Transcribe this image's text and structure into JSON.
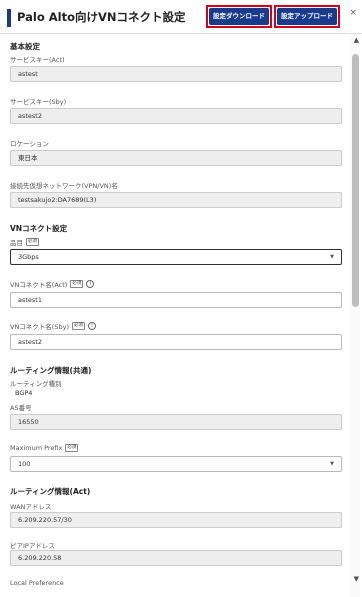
{
  "header": {
    "title": "Palo Alto向けVNコネクト設定",
    "download_label": "設定ダウンロード",
    "upload_label": "設定アップロード",
    "close_glyph": "×"
  },
  "basic": {
    "heading": "基本設定",
    "service_key_act_label": "サービスキー(Act)",
    "service_key_act_value": "astest",
    "service_key_sby_label": "サービスキー(Sby)",
    "service_key_sby_value": "astest2",
    "location_label": "ロケーション",
    "location_value": "東日本",
    "dest_network_label": "接続先仮想ネットワーク(VPN/VN)名",
    "dest_network_value": "testsakujo2:DA7689(L3)"
  },
  "vn": {
    "heading": "VNコネクト設定",
    "item_label": "品目",
    "item_value": "3Gbps",
    "name_act_label": "VNコネクト名(Act)",
    "name_act_value": "astest1",
    "name_sby_label": "VNコネクト名(Sby)",
    "name_sby_value": "astest2"
  },
  "routing_common": {
    "heading": "ルーティング情報(共通)",
    "type_label": "ルーティング種別",
    "type_value": "BGP4",
    "as_label": "AS番号",
    "as_value": "16550",
    "max_prefix_label": "Maximum Prefix",
    "max_prefix_value": "100"
  },
  "routing_act": {
    "heading": "ルーティング情報(Act)",
    "wan_label": "WANアドレス",
    "wan_value": "6.209.220.57/30",
    "peer_label": "ピアIPアドレス",
    "peer_value": "6.209.220.58",
    "local_pref_label": "Local Preference"
  },
  "common": {
    "required": "必須",
    "info": "i",
    "caret": "▼",
    "scroll_up": "▲",
    "scroll_down": "▼"
  }
}
